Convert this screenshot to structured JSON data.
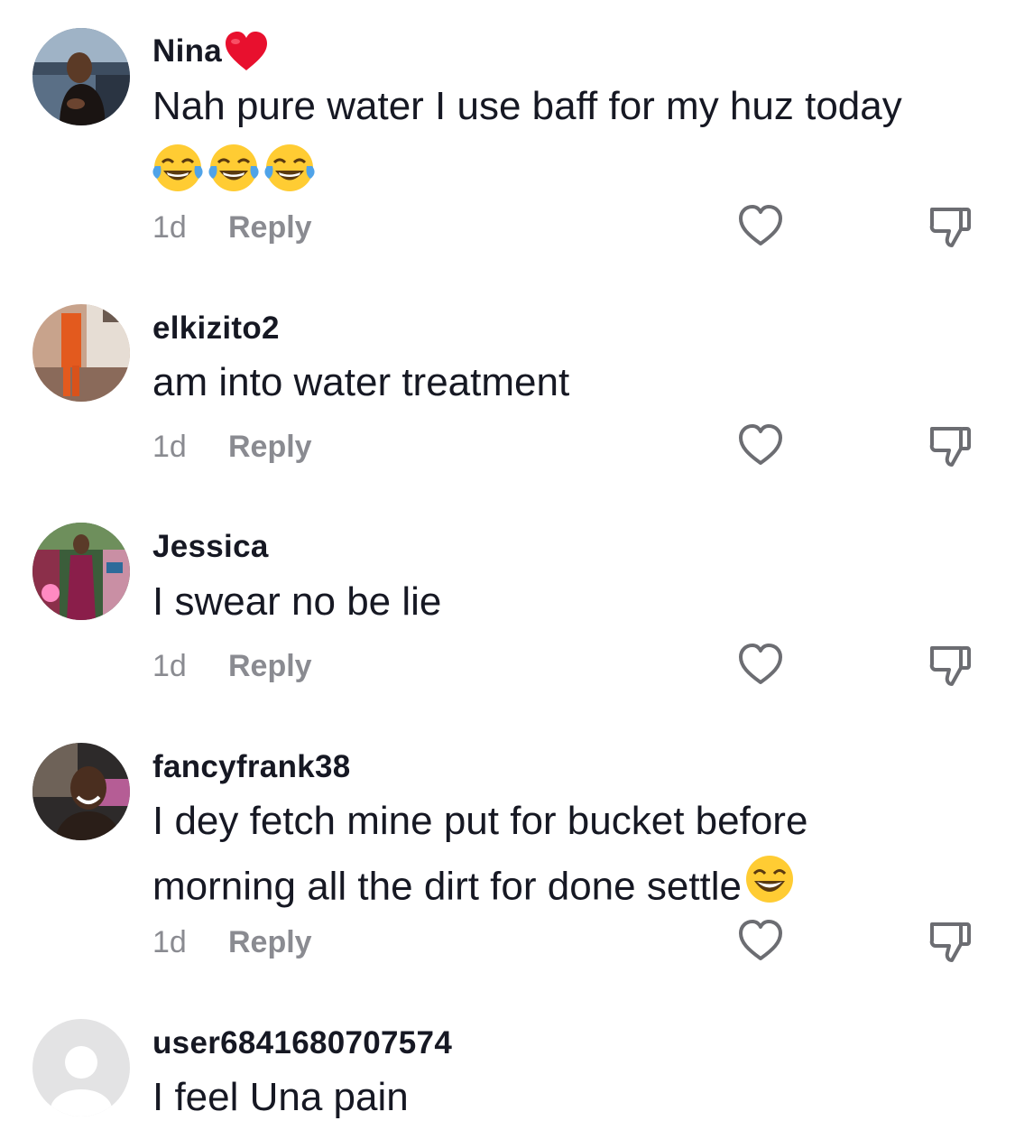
{
  "comments": [
    {
      "username": "Nina",
      "username_emoji": "red-heart-icon",
      "text": "Nah pure water I use baff for my huz today",
      "emojis": [
        "face-with-tears-of-joy-icon",
        "face-with-tears-of-joy-icon",
        "face-with-tears-of-joy-icon"
      ],
      "time": "1d",
      "reply_label": "Reply"
    },
    {
      "username": "elkizito2",
      "text": "am into water treatment",
      "time": "1d",
      "reply_label": "Reply"
    },
    {
      "username": "Jessica",
      "text": "I swear no be lie",
      "time": "1d",
      "reply_label": "Reply"
    },
    {
      "username": "fancyfrank38",
      "text": "I dey fetch mine put for bucket before morning all the dirt for done settle",
      "trailing_emoji": "grinning-face-with-smiling-eyes-icon",
      "time": "1d",
      "reply_label": "Reply"
    },
    {
      "username": "user6841680707574",
      "text": "I feel Una pain"
    }
  ],
  "icons": {
    "like": "heart-outline-icon",
    "dislike": "thumbs-down-icon",
    "default_avatar": "default-avatar-icon"
  },
  "colors": {
    "text_primary": "#161823",
    "text_secondary": "#8a8b91",
    "icon_stroke": "#6c6d72",
    "heart_red": "#e8102e"
  }
}
